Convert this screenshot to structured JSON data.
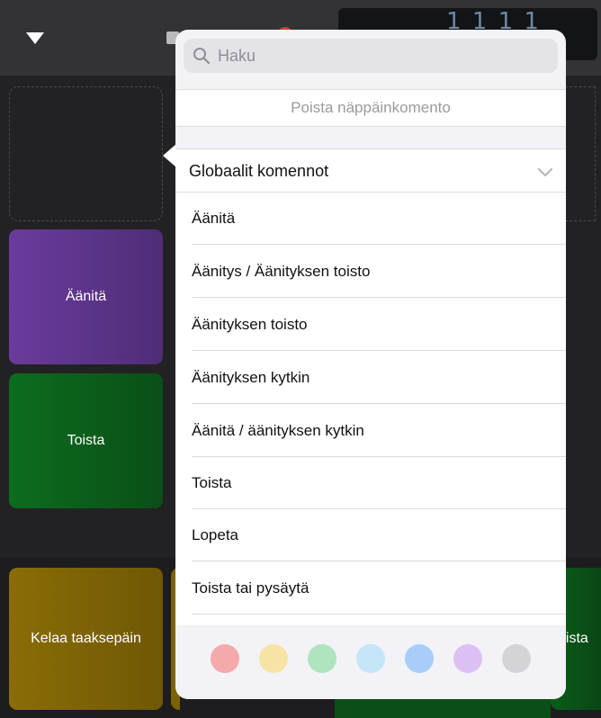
{
  "top_bar": {
    "lcd_text": "1 1 1    1"
  },
  "pads": {
    "record_label": "Äänitä",
    "play_label": "Toista",
    "rewind_label": "Kelaa taaksepäin",
    "right_partial_label": "oista",
    "record_color": "#6a3b9c",
    "play_color": "#0c6d1e",
    "rewind_color": "#8a6d07"
  },
  "popover": {
    "search": {
      "placeholder": "Haku"
    },
    "remove_label": "Poista näppäinkomento",
    "group_title": "Globaalit komennot",
    "items": [
      {
        "label": "Äänitä"
      },
      {
        "label": "Äänitys / Äänityksen toisto"
      },
      {
        "label": "Äänityksen toisto"
      },
      {
        "label": "Äänityksen kytkin"
      },
      {
        "label": "Äänitä / äänityksen kytkin"
      },
      {
        "label": "Toista"
      },
      {
        "label": "Lopeta"
      },
      {
        "label": "Toista tai pysäytä"
      }
    ],
    "colors": [
      "#f4a9ab",
      "#f7e3a3",
      "#aee4bf",
      "#c4e6f8",
      "#a7cdf8",
      "#dcc0f3",
      "#d3d3d8"
    ]
  }
}
